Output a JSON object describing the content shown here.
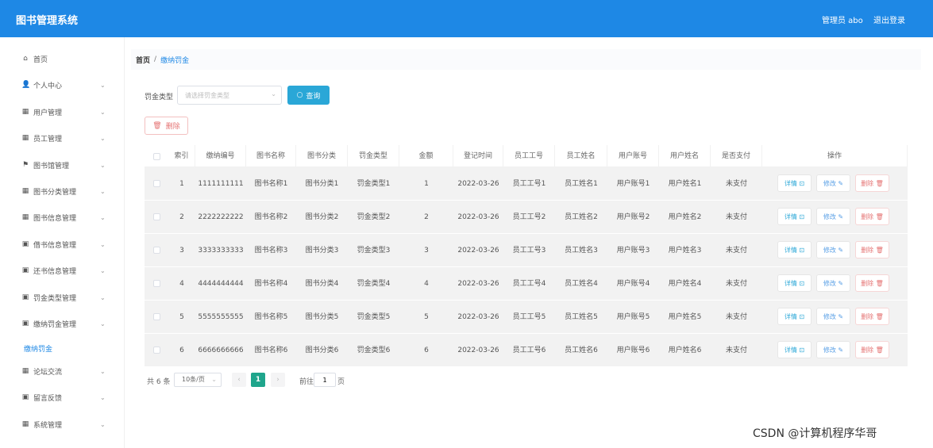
{
  "header": {
    "title": "图书管理系统",
    "admin": "管理员 abo",
    "logout": "退出登录"
  },
  "sidebar": {
    "items": [
      {
        "icon": "⌂",
        "label": "首页",
        "chevron": false
      },
      {
        "icon": "👤",
        "label": "个人中心",
        "chevron": true
      },
      {
        "icon": "▦",
        "label": "用户管理",
        "chevron": true
      },
      {
        "icon": "▦",
        "label": "员工管理",
        "chevron": true
      },
      {
        "icon": "⚑",
        "label": "图书馆管理",
        "chevron": true
      },
      {
        "icon": "▦",
        "label": "图书分类管理",
        "chevron": true
      },
      {
        "icon": "▦",
        "label": "图书信息管理",
        "chevron": true
      },
      {
        "icon": "▣",
        "label": "借书信息管理",
        "chevron": true
      },
      {
        "icon": "▣",
        "label": "还书信息管理",
        "chevron": true
      },
      {
        "icon": "▣",
        "label": "罚金类型管理",
        "chevron": true
      },
      {
        "icon": "▣",
        "label": "缴纳罚金管理",
        "chevron": true
      },
      {
        "icon": "▦",
        "label": "论坛交流",
        "chevron": true
      },
      {
        "icon": "▣",
        "label": "留言反馈",
        "chevron": true
      },
      {
        "icon": "▦",
        "label": "系统管理",
        "chevron": true
      }
    ],
    "active_sub": "缴纳罚金"
  },
  "breadcrumb": {
    "home": "首页",
    "sep": "/",
    "current": "缴纳罚金"
  },
  "filter": {
    "label": "罚金类型",
    "placeholder": "请选择罚金类型",
    "query": "查询"
  },
  "actions": {
    "delete": "删除"
  },
  "table": {
    "headers": [
      "索引",
      "缴纳编号",
      "图书名称",
      "图书分类",
      "罚金类型",
      "金额",
      "登记时间",
      "员工工号",
      "员工姓名",
      "用户账号",
      "用户姓名",
      "是否支付",
      "操作"
    ],
    "rows": [
      [
        "1",
        "1111111111",
        "图书名称1",
        "图书分类1",
        "罚金类型1",
        "1",
        "2022-03-26",
        "员工工号1",
        "员工姓名1",
        "用户账号1",
        "用户姓名1",
        "未支付"
      ],
      [
        "2",
        "2222222222",
        "图书名称2",
        "图书分类2",
        "罚金类型2",
        "2",
        "2022-03-26",
        "员工工号2",
        "员工姓名2",
        "用户账号2",
        "用户姓名2",
        "未支付"
      ],
      [
        "3",
        "3333333333",
        "图书名称3",
        "图书分类3",
        "罚金类型3",
        "3",
        "2022-03-26",
        "员工工号3",
        "员工姓名3",
        "用户账号3",
        "用户姓名3",
        "未支付"
      ],
      [
        "4",
        "4444444444",
        "图书名称4",
        "图书分类4",
        "罚金类型4",
        "4",
        "2022-03-26",
        "员工工号4",
        "员工姓名4",
        "用户账号4",
        "用户姓名4",
        "未支付"
      ],
      [
        "5",
        "5555555555",
        "图书名称5",
        "图书分类5",
        "罚金类型5",
        "5",
        "2022-03-26",
        "员工工号5",
        "员工姓名5",
        "用户账号5",
        "用户姓名5",
        "未支付"
      ],
      [
        "6",
        "6666666666",
        "图书名称6",
        "图书分类6",
        "罚金类型6",
        "6",
        "2022-03-26",
        "员工工号6",
        "员工姓名6",
        "用户账号6",
        "用户姓名6",
        "未支付"
      ]
    ],
    "ops": {
      "detail": "详情 ⊡",
      "edit": "修改 ✎",
      "delete": "删除 🗑"
    }
  },
  "pager": {
    "total": "共 6 条",
    "page_size": "10条/页",
    "current_page": "1",
    "goto_label": "前往",
    "goto_value": "1",
    "page_suffix": "页"
  },
  "watermark": "CSDN @计算机程序华哥",
  "colors": {
    "topbar": "#1e88e5",
    "query_button": "#2aa7d7",
    "active_page": "#1fa58c",
    "delete": "#e57373"
  }
}
